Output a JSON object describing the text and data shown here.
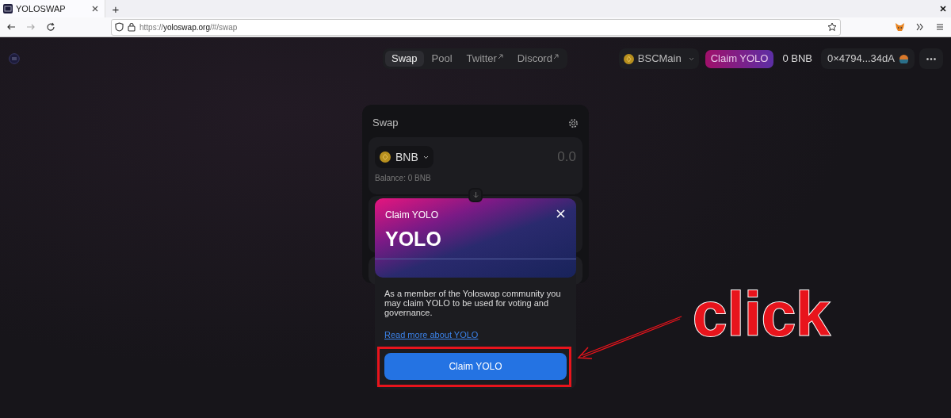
{
  "browser": {
    "tab_title": "YOLOSWAP",
    "new_tab": "+",
    "url_scheme": "https://",
    "url_host": "yoloswap.org",
    "url_path": "/#/swap"
  },
  "nav": {
    "tabs": [
      {
        "label": "Swap",
        "selected": true,
        "external": false
      },
      {
        "label": "Pool",
        "selected": false,
        "external": false
      },
      {
        "label": "Twitter",
        "selected": false,
        "external": true
      },
      {
        "label": "Discord",
        "selected": false,
        "external": true
      }
    ],
    "network": "BSCMain",
    "claim_button": "Claim YOLO",
    "balance": "0 BNB",
    "account": "0×4794...34dA"
  },
  "swap": {
    "title": "Swap",
    "token": "BNB",
    "amount_placeholder": "0.0",
    "balance": "Balance: 0 BNB"
  },
  "modal": {
    "subtitle": "Claim YOLO",
    "title": "YOLO",
    "body": "As a member of the Yoloswap community you may claim YOLO to be used for voting and governance.",
    "link": "Read more about YOLO",
    "button": "Claim YOLO"
  },
  "annotation": {
    "text": "click"
  }
}
